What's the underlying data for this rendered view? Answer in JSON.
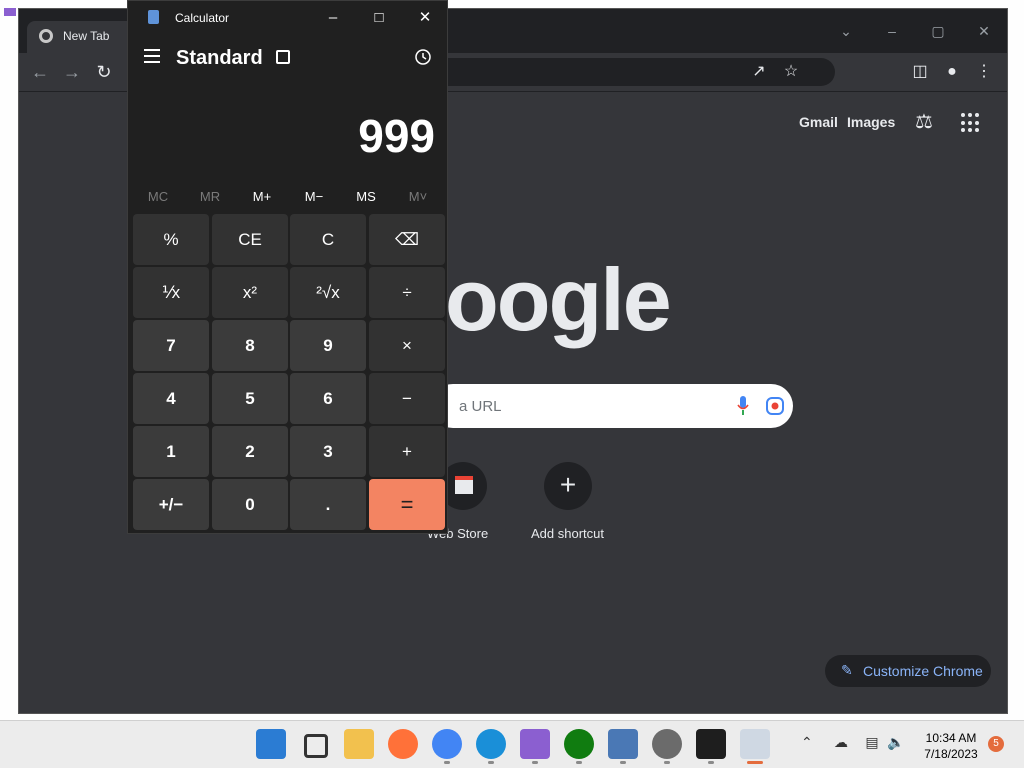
{
  "browser": {
    "tab_title": "New Tab",
    "search_placeholder": "a URL",
    "header_links": [
      "Gmail",
      "Images"
    ],
    "logo_text": "oogle",
    "shortcuts": [
      "Web Store",
      "Add shortcut"
    ],
    "customize_label": "Customize Chrome",
    "icons": [
      "back-icon",
      "forward-icon",
      "reload-icon",
      "share-icon",
      "bookmark-star-icon",
      "side-panel-icon",
      "profile-icon",
      "menu-dots-icon",
      "labs-icon",
      "apps-grid-icon",
      "mic-icon",
      "lens-icon",
      "pencil-icon"
    ]
  },
  "calculator": {
    "title": "Calculator",
    "mode": "Standard",
    "display": "999",
    "memory_buttons": [
      "MC",
      "MR",
      "M+",
      "M−",
      "MS",
      "M˅"
    ],
    "keys": [
      [
        "%",
        "CE",
        "C",
        "⌫"
      ],
      [
        "⅟x",
        "x²",
        "²√x",
        "÷"
      ],
      [
        "7",
        "8",
        "9",
        "×"
      ],
      [
        "4",
        "5",
        "6",
        "−"
      ],
      [
        "1",
        "2",
        "3",
        "+"
      ],
      [
        "+/−",
        "0",
        ".",
        "="
      ]
    ],
    "accent_color": "#f38462"
  },
  "taskbar": {
    "time": "10:34 AM",
    "date": "7/18/2023",
    "notification_count": "5",
    "apps": [
      "start",
      "search",
      "file-explorer",
      "firefox",
      "chrome",
      "edge",
      "clipchamp",
      "xbox",
      "remote-desktop",
      "settings",
      "terminal",
      "calculator"
    ]
  }
}
